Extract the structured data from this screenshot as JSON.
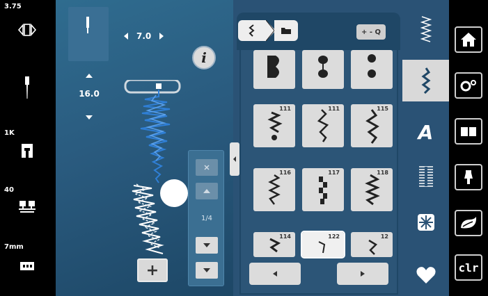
{
  "status": {
    "top_value": "3.75",
    "presser_foot": "1K",
    "tension": "40",
    "feed_height": "7mm"
  },
  "stitch_settings": {
    "width": "7.0",
    "length": "16.0"
  },
  "layers": {
    "count": "1/4"
  },
  "stitch_grid": {
    "zoom_label": "+ - Q",
    "cells": [
      {
        "num": ""
      },
      {
        "num": ""
      },
      {
        "num": ""
      },
      {
        "num": "111"
      },
      {
        "num": "111"
      },
      {
        "num": "115"
      },
      {
        "num": "116"
      },
      {
        "num": "117"
      },
      {
        "num": "118"
      },
      {
        "num": "114"
      },
      {
        "num": "122"
      },
      {
        "num": "12"
      }
    ]
  },
  "categories": [
    "practical-stitches-icon",
    "decorative-stitches-icon",
    "alphabets-icon",
    "buttonholes-icon",
    "quilt-stitches-icon",
    "favorites-icon"
  ],
  "right_buttons": {
    "home": "home-icon",
    "settings": "settings-icon",
    "tutorial": "tutorial-icon",
    "consultant": "consultant-icon",
    "eco": "eco-icon",
    "clr": "clr"
  },
  "colors": {
    "main_bg": "#2a5b7f",
    "stitch_blue": "#2f7fd6",
    "stitch_white": "#ffffff",
    "button_grey": "#dcdcdc"
  }
}
